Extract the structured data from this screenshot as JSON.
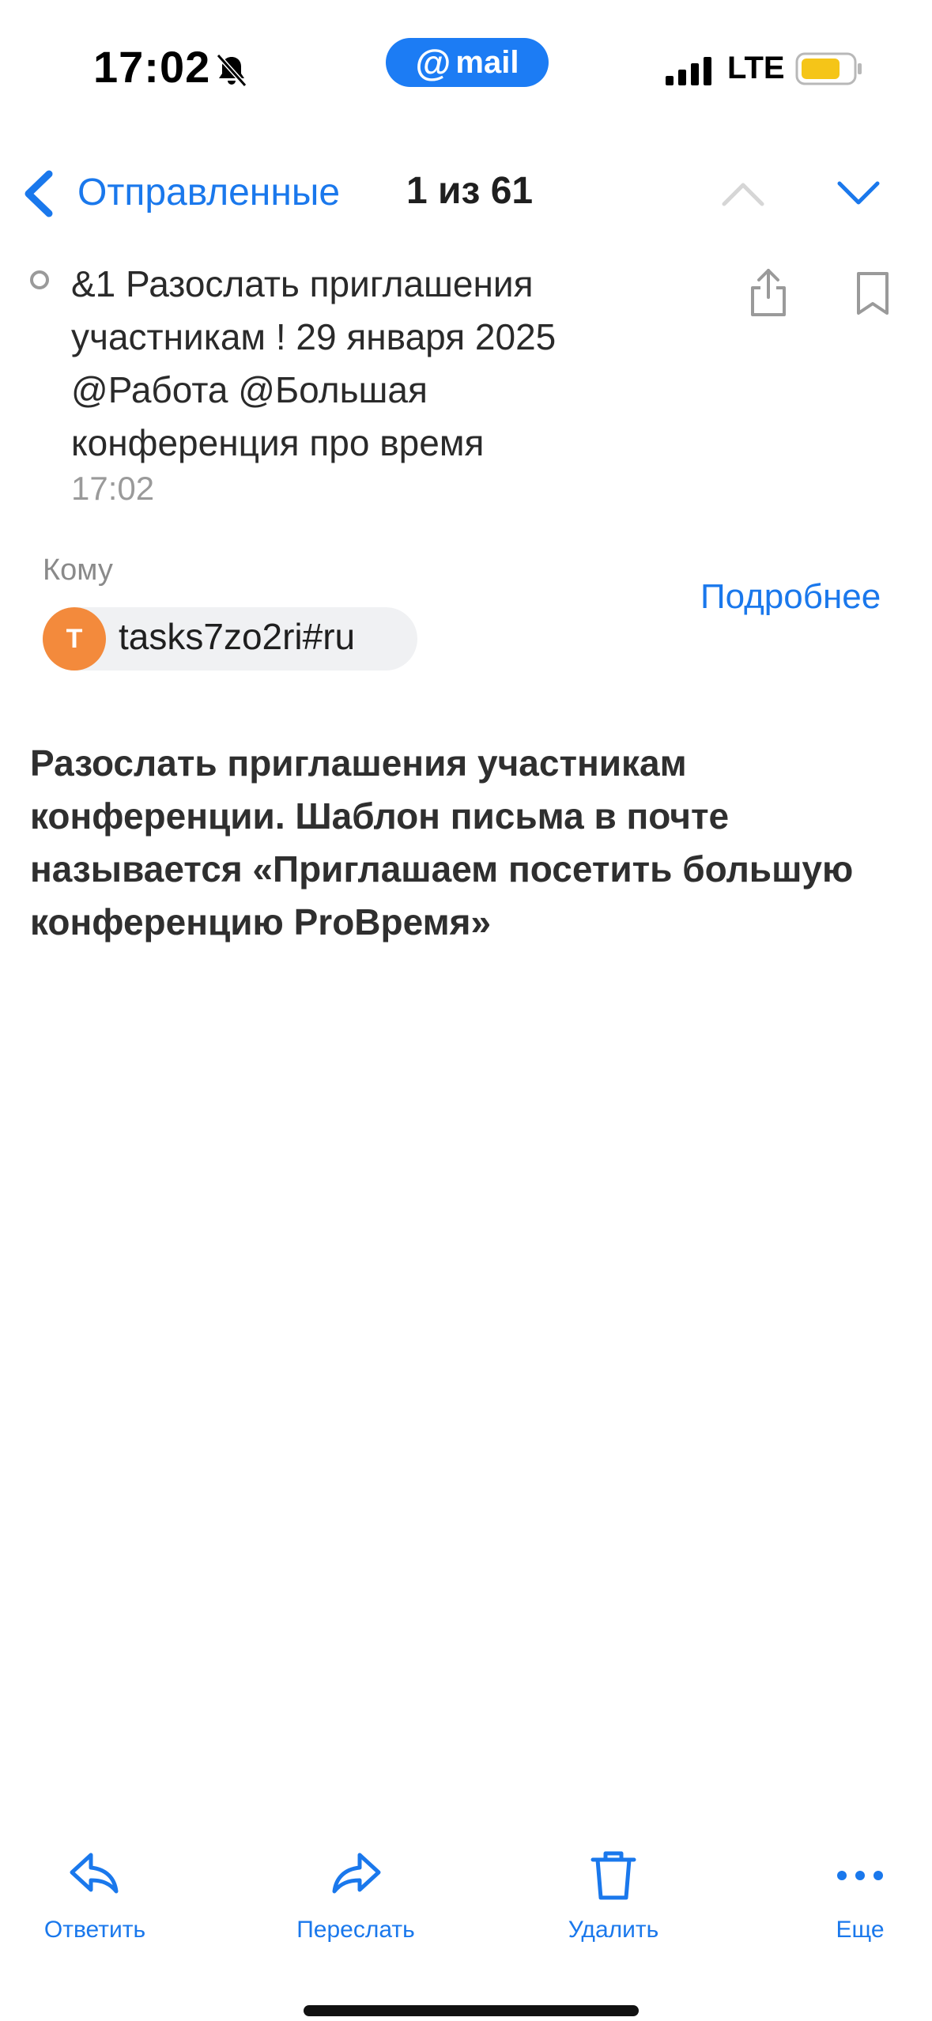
{
  "status_bar": {
    "time": "17:02",
    "app_pill": "mail",
    "network": "LTE",
    "accent_color": "#1c7cf4",
    "battery_color": "#f5c518"
  },
  "nav": {
    "folder": "Отправленные",
    "counter": "1 из 61"
  },
  "message": {
    "subject": "&1 Разослать приглашения участникам ! 29 января 2025 @Работа @Большая конференция про время",
    "time": "17:02",
    "to_label": "Кому",
    "details_link": "Подробнее",
    "recipient": {
      "initial": "T",
      "email": "tasks7zo2ri#ru",
      "avatar_color": "#f38a3c"
    },
    "body": "Разослать приглашения участникам конференции. Шаблон письма в почте называется «Приглашаем посетить большую конференцию ProВремя»"
  },
  "toolbar": {
    "reply": "Ответить",
    "forward": "Переслать",
    "delete": "Удалить",
    "more": "Еще"
  }
}
